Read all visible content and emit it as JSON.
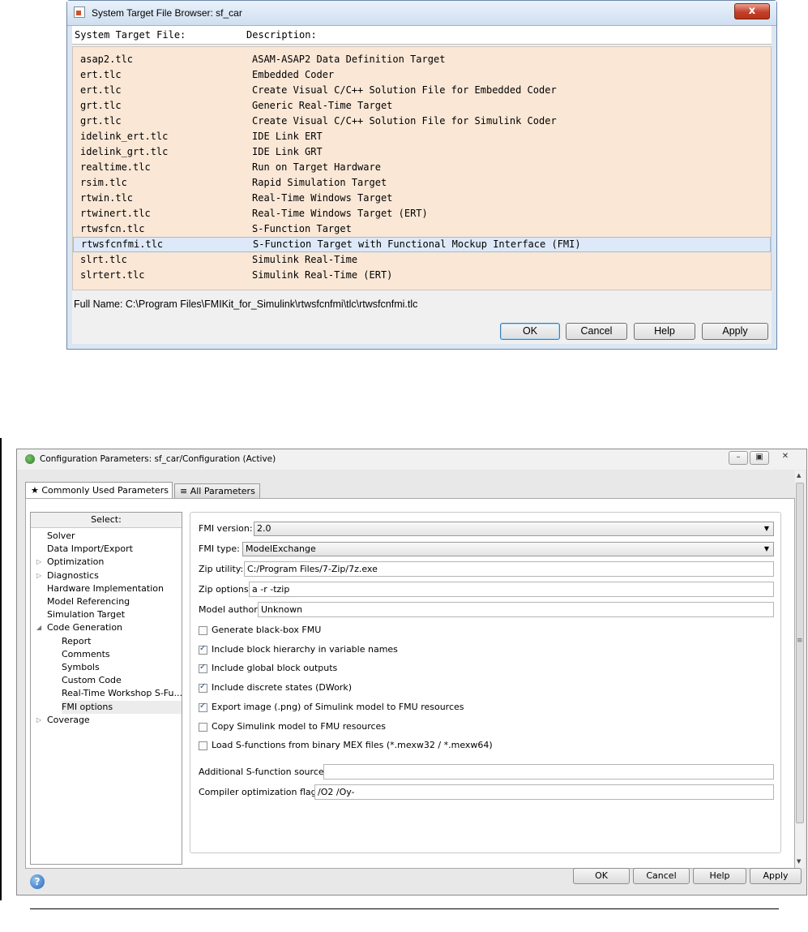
{
  "target_browser": {
    "title": "System Target File Browser: sf_car",
    "close_label": "x",
    "columns": [
      "System Target File:",
      "Description:"
    ],
    "rows": [
      {
        "file": "asap2.tlc",
        "desc": "ASAM-ASAP2 Data Definition Target"
      },
      {
        "file": "ert.tlc",
        "desc": "Embedded Coder"
      },
      {
        "file": "ert.tlc",
        "desc": "Create Visual C/C++ Solution File for Embedded Coder"
      },
      {
        "file": "grt.tlc",
        "desc": "Generic Real-Time Target"
      },
      {
        "file": "grt.tlc",
        "desc": "Create Visual C/C++ Solution File for Simulink Coder"
      },
      {
        "file": "idelink_ert.tlc",
        "desc": "IDE Link ERT"
      },
      {
        "file": "idelink_grt.tlc",
        "desc": "IDE Link GRT"
      },
      {
        "file": "realtime.tlc",
        "desc": "Run on Target Hardware"
      },
      {
        "file": "rsim.tlc",
        "desc": "Rapid Simulation Target"
      },
      {
        "file": "rtwin.tlc",
        "desc": "Real-Time Windows Target"
      },
      {
        "file": "rtwinert.tlc",
        "desc": "Real-Time Windows Target (ERT)"
      },
      {
        "file": "rtwsfcn.tlc",
        "desc": "S-Function Target"
      },
      {
        "file": "rtwsfcnfmi.tlc",
        "desc": "S-Function Target with Functional Mockup Interface (FMI)"
      },
      {
        "file": "slrt.tlc",
        "desc": "Simulink Real-Time"
      },
      {
        "file": "slrtert.tlc",
        "desc": "Simulink Real-Time (ERT)"
      }
    ],
    "selected_row": "rtwsfcnfmi.tlc",
    "full_name": "Full Name: C:\\Program Files\\FMIKit_for_Simulink\\rtwsfcnfmi\\tlc\\rtwsfcnfmi.tlc",
    "buttons": {
      "ok": "OK",
      "cancel": "Cancel",
      "help": "Help",
      "apply": "Apply"
    }
  },
  "config_params": {
    "title": "Configuration Parameters: sf_car/Configuration (Active)",
    "window_controls": {
      "minimize": "–",
      "maximize": "▣",
      "close": "✕"
    },
    "tabs": [
      {
        "label": "★ Commonly Used Parameters",
        "active": true
      },
      {
        "label": "≡ All Parameters",
        "active": false
      }
    ],
    "nav": {
      "header": "Select:",
      "items": [
        {
          "label": "Solver",
          "indent": 0,
          "arrow": ""
        },
        {
          "label": "Data Import/Export",
          "indent": 0,
          "arrow": ""
        },
        {
          "label": "Optimization",
          "indent": 0,
          "arrow": "▷"
        },
        {
          "label": "Diagnostics",
          "indent": 0,
          "arrow": "▷"
        },
        {
          "label": "Hardware Implementation",
          "indent": 0,
          "arrow": ""
        },
        {
          "label": "Model Referencing",
          "indent": 0,
          "arrow": ""
        },
        {
          "label": "Simulation Target",
          "indent": 0,
          "arrow": ""
        },
        {
          "label": "Code Generation",
          "indent": 0,
          "arrow": "◢"
        },
        {
          "label": "Report",
          "indent": 1,
          "arrow": ""
        },
        {
          "label": "Comments",
          "indent": 1,
          "arrow": ""
        },
        {
          "label": "Symbols",
          "indent": 1,
          "arrow": ""
        },
        {
          "label": "Custom Code",
          "indent": 1,
          "arrow": ""
        },
        {
          "label": "Real-Time Workshop S-Fu...",
          "indent": 1,
          "arrow": ""
        },
        {
          "label": "FMI options",
          "indent": 1,
          "arrow": "",
          "selected": true
        },
        {
          "label": "Coverage",
          "indent": 0,
          "arrow": "▷"
        }
      ]
    },
    "fields": {
      "fmi_version": {
        "label": "FMI version:",
        "value": "2.0"
      },
      "fmi_type": {
        "label": "FMI type:",
        "value": "ModelExchange"
      },
      "zip_utility": {
        "label": "Zip utility:",
        "value": "C:/Program Files/7-Zip/7z.exe"
      },
      "zip_options": {
        "label": "Zip options:",
        "value": "a -r -tzip"
      },
      "model_author": {
        "label": "Model author",
        "value": "Unknown"
      },
      "additional_sources": {
        "label": "Additional S-function sources",
        "value": ""
      },
      "compiler_flags": {
        "label": "Compiler optimization flags",
        "value": "/O2 /Oy-"
      }
    },
    "checkboxes": [
      {
        "label": "Generate black-box FMU",
        "checked": false
      },
      {
        "label": "Include block hierarchy in variable names",
        "checked": true
      },
      {
        "label": "Include global block outputs",
        "checked": true
      },
      {
        "label": "Include discrete states (DWork)",
        "checked": true
      },
      {
        "label": "Export image (.png) of Simulink model to FMU resources",
        "checked": true
      },
      {
        "label": "Copy Simulink model to FMU resources",
        "checked": false
      },
      {
        "label": "Load S-functions from binary MEX files (*.mexw32 / *.mexw64)",
        "checked": false
      }
    ],
    "help_icon": "?",
    "scroll": {
      "up": "▲",
      "down": "▼",
      "grip": "≡"
    },
    "buttons": {
      "ok": "OK",
      "cancel": "Cancel",
      "help": "Help",
      "apply": "Apply"
    }
  }
}
